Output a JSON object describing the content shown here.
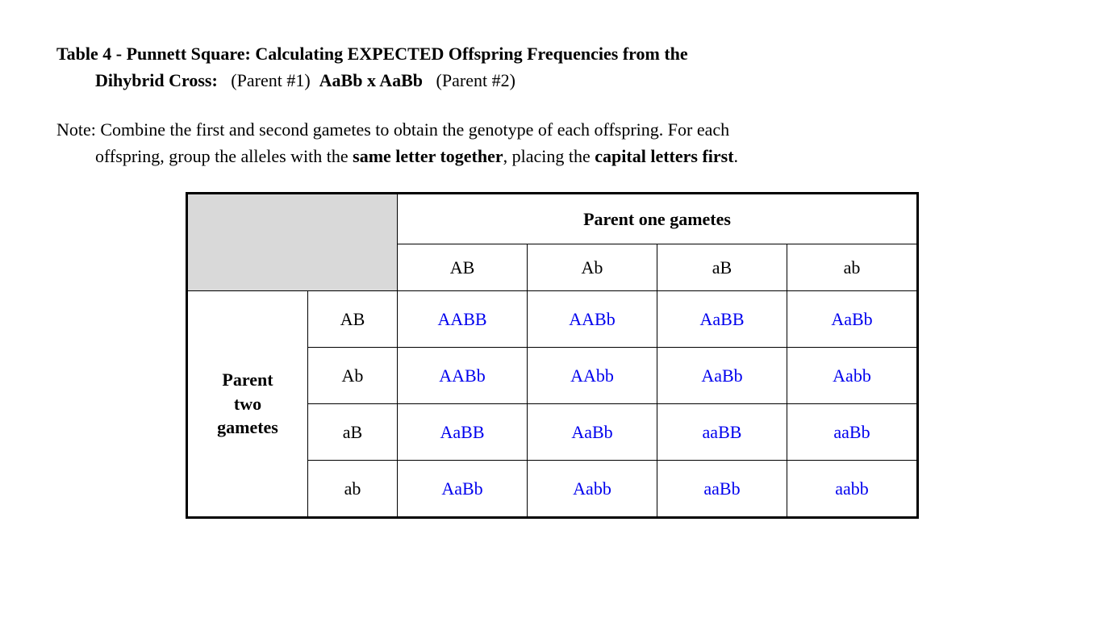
{
  "title": {
    "line1": "Table 4 - Punnett Square: Calculating EXPECTED Offspring Frequencies from the",
    "line2_bold1": "Dihybrid Cross:",
    "parent1_label": "(Parent #1)",
    "cross_center": "AaBb   x   AaBb",
    "parent2_label": "(Parent #2)"
  },
  "note": {
    "prefix": "Note: Combine the first and second gametes to obtain the genotype of each offspring. For each",
    "line2_seg1": "offspring, group the alleles with the ",
    "bold1": "same letter together",
    "seg2": ", placing the ",
    "bold2": "capital letters first",
    "seg3": "."
  },
  "chart_data": {
    "type": "table",
    "title": "Punnett Square dihybrid cross AaBb x AaBb",
    "header_parent_one": "Parent one gametes",
    "header_parent_two": "Parent two gametes",
    "col_gametes": [
      "AB",
      "Ab",
      "aB",
      "ab"
    ],
    "row_gametes": [
      "AB",
      "Ab",
      "aB",
      "ab"
    ],
    "cells": [
      [
        "AABB",
        "AABb",
        "AaBB",
        "AaBb"
      ],
      [
        "AABb",
        "AAbb",
        "AaBb",
        "Aabb"
      ],
      [
        "AaBB",
        "AaBb",
        "aaBB",
        "aaBb"
      ],
      [
        "AaBb",
        "Aabb",
        "aaBb",
        "aabb"
      ]
    ]
  }
}
